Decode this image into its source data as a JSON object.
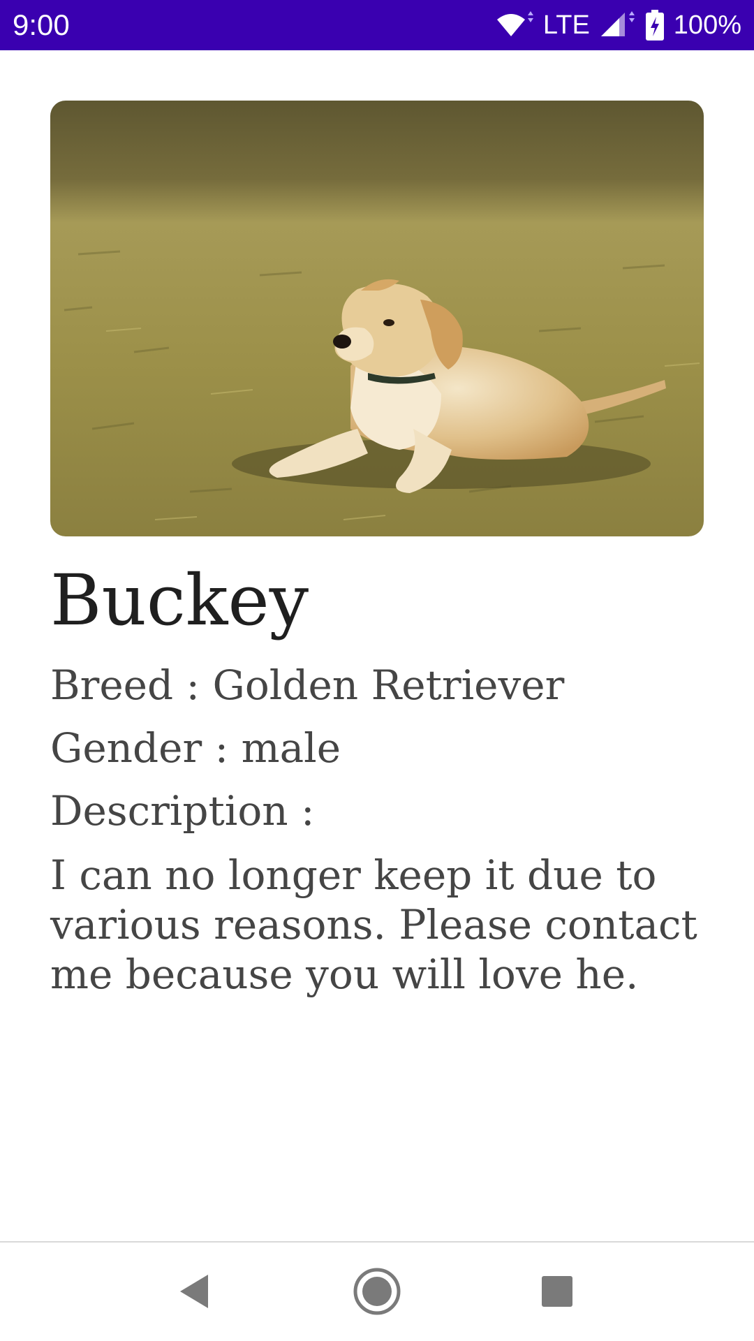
{
  "status_bar": {
    "time": "9:00",
    "network": "LTE",
    "battery": "100%",
    "icons": [
      "wifi-icon",
      "cellular-signal-icon",
      "battery-charging-icon"
    ]
  },
  "pet": {
    "photo": "golden-retriever-puppy-on-grass",
    "name": "Buckey",
    "breed_line": "Breed : Golden Retriever",
    "gender_line": "Gender : male",
    "description_label": "Description :",
    "description": "I can no longer keep it due to various reasons. Please contact me because you will love he."
  },
  "nav_bar": {
    "icons": [
      "back-icon",
      "home-icon",
      "recents-icon"
    ]
  },
  "colors": {
    "status_bar": "#3a00b0",
    "title_text": "#1f1f1f",
    "body_text": "#454545"
  }
}
